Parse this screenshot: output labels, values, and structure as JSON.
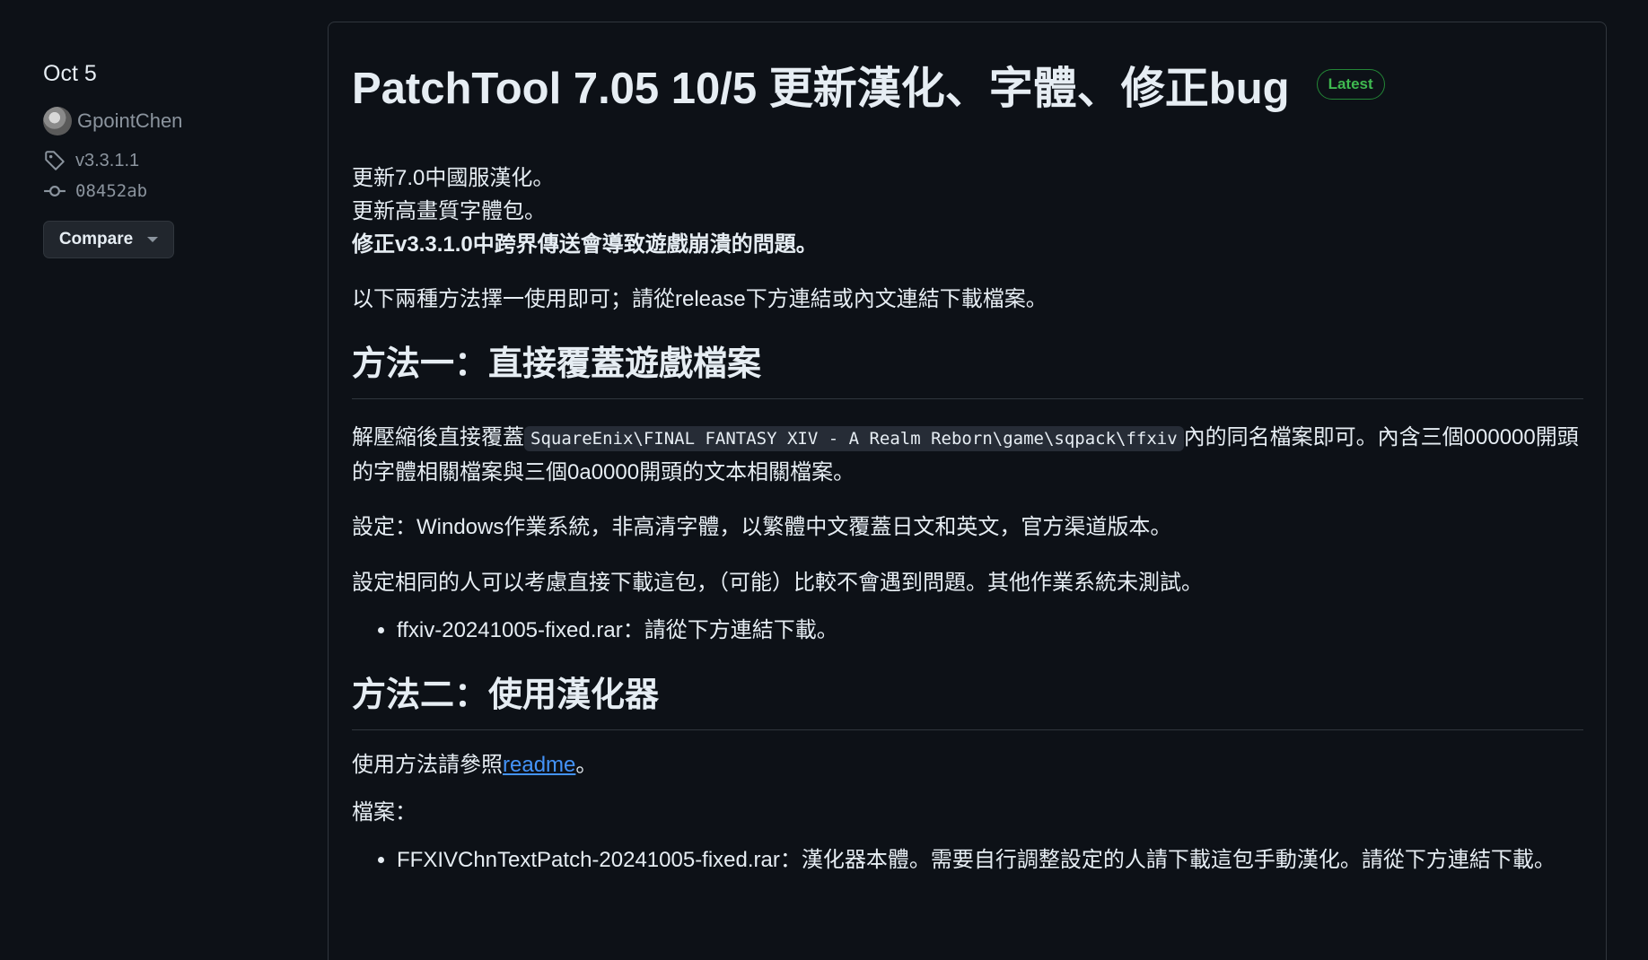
{
  "sidebar": {
    "date": "Oct 5",
    "author": "GpointChen",
    "tag": "v3.3.1.1",
    "commit": "08452ab",
    "compare_label": "Compare"
  },
  "release": {
    "title": "PatchTool 7.05 10/5 更新漢化、字體、修正bug",
    "badge": "Latest",
    "intro_line1": "更新7.0中國服漢化。",
    "intro_line2": "更新高畫質字體包。",
    "intro_line3": "修正v3.3.1.0中跨界傳送會導致遊戲崩潰的問題。",
    "choose": "以下兩種方法擇一使用即可；請從release下方連結或內文連結下載檔案。",
    "method1_heading": "方法一：直接覆蓋遊戲檔案",
    "method1_p1_before": "解壓縮後直接覆蓋",
    "method1_path": "SquareEnix\\FINAL FANTASY XIV - A Realm Reborn\\game\\sqpack\\ffxiv",
    "method1_p1_after": "內的同名檔案即可。內含三個000000開頭的字體相關檔案與三個0a0000開頭的文本相關檔案。",
    "method1_settings": "設定：Windows作業系統，非高清字體，以繁體中文覆蓋日文和英文，官方渠道版本。",
    "method1_note": "設定相同的人可以考慮直接下載這包，（可能）比較不會遇到問題。其他作業系統未測試。",
    "method1_file": "ffxiv-20241005-fixed.rar：請從下方連結下載。",
    "method2_heading": "方法二：使用漢化器",
    "method2_usage_before": "使用方法請參照",
    "method2_usage_link": "readme",
    "method2_usage_after": "。",
    "files_label": "檔案：",
    "method2_file": "FFXIVChnTextPatch-20241005-fixed.rar：漢化器本體。需要自行調整設定的人請下載這包手動漢化。請從下方連結下載。"
  },
  "colors": {
    "background": "#0d1117",
    "text": "#e6edf3",
    "muted": "#8b949e",
    "badge_green": "#3fb950",
    "link": "#4493f8"
  }
}
